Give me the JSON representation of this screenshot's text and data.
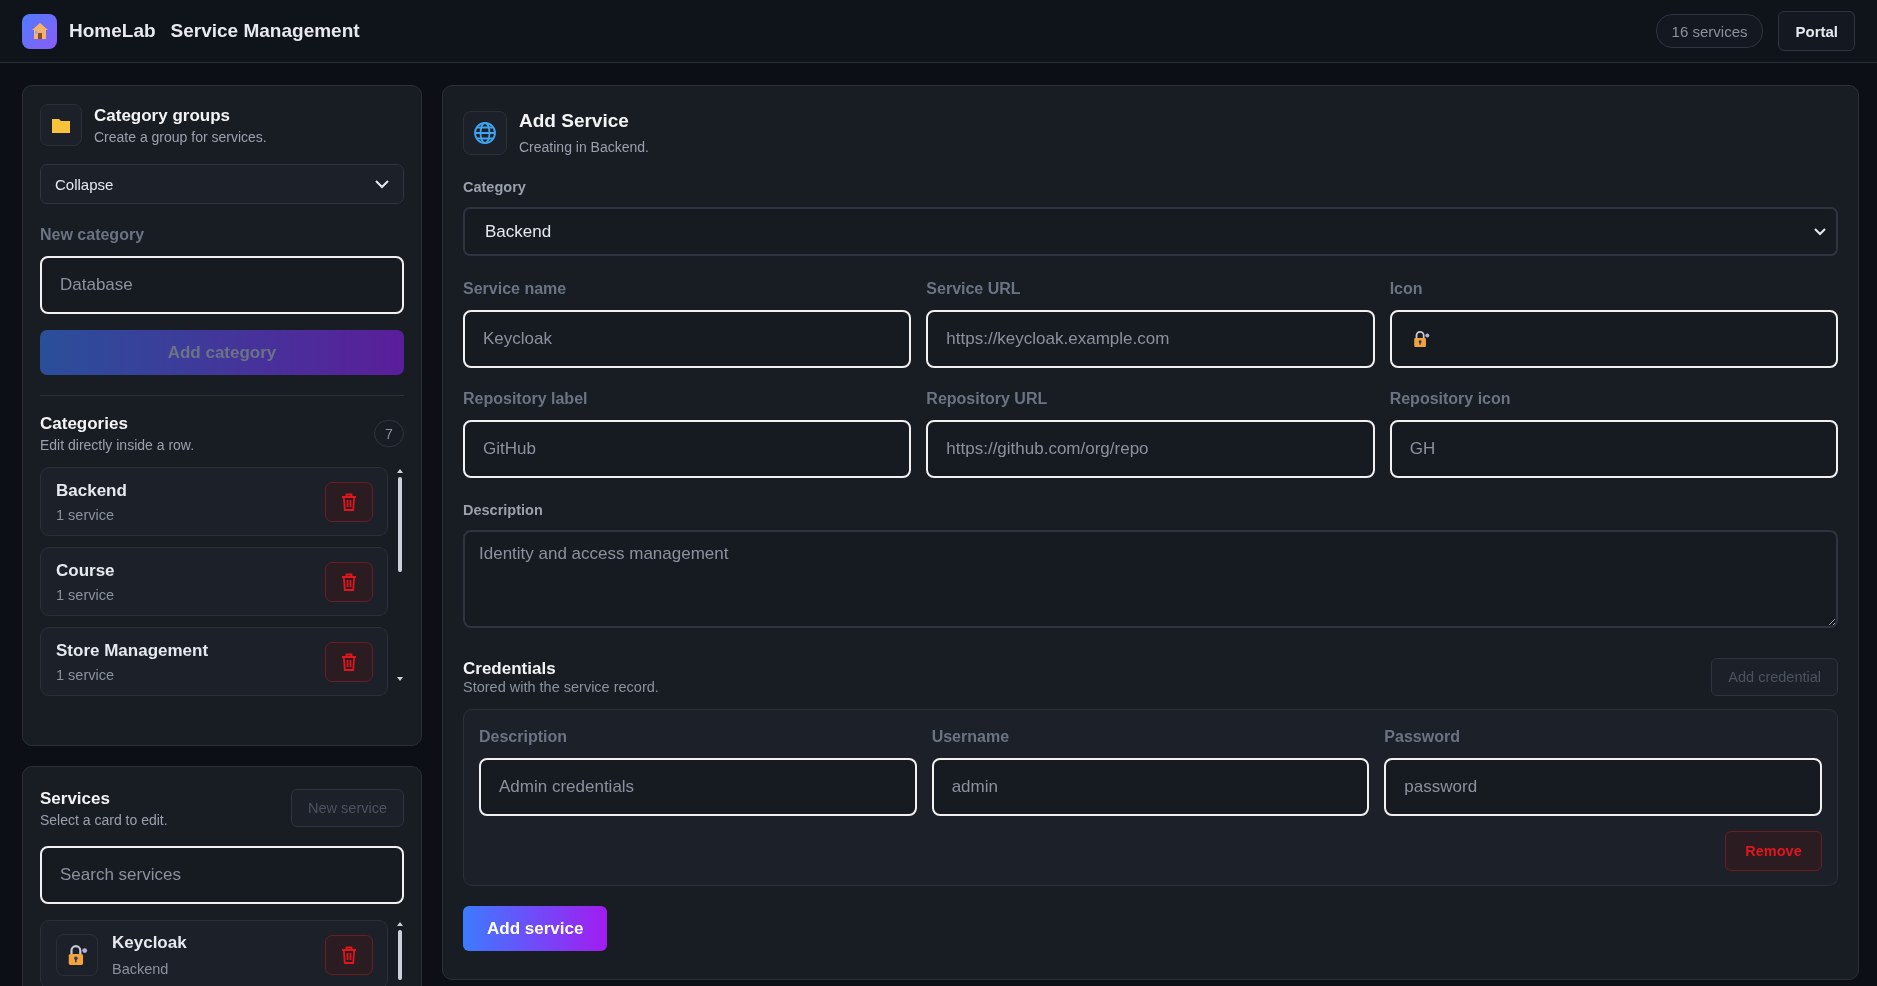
{
  "header": {
    "brand": "HomeLab",
    "title": "Service Management",
    "count_badge": "16 services",
    "portal_button": "Portal"
  },
  "category_groups": {
    "title": "Category groups",
    "subtitle": "Create a group for services.",
    "mode_select": {
      "value": "Collapse"
    },
    "new_category": {
      "label": "New category",
      "placeholder": "Database"
    },
    "add_button": {
      "label": "Add category",
      "disabled": true
    },
    "categories_title": "Categories",
    "categories_subtitle": "Edit directly inside a row.",
    "count": "7",
    "items": [
      {
        "name": "Backend",
        "count": "1 service"
      },
      {
        "name": "Course",
        "count": "1 service"
      },
      {
        "name": "Store Management",
        "count": "1 service"
      }
    ]
  },
  "services": {
    "title": "Services",
    "subtitle": "Select a card to edit.",
    "new_button": {
      "label": "New service",
      "disabled": true
    },
    "search": {
      "placeholder": "Search services"
    },
    "items": [
      {
        "name": "Keycloak",
        "category": "Backend"
      }
    ]
  },
  "form": {
    "title": "Add Service",
    "subtitle": "Creating in Backend.",
    "category": {
      "label": "Category",
      "value": "Backend"
    },
    "fields": [
      {
        "kind": "text",
        "label": "Service name",
        "placeholder": "Keycloak"
      },
      {
        "kind": "text",
        "label": "Service URL",
        "placeholder": "https://keycloak.example.com"
      },
      {
        "kind": "icon",
        "label": "Icon"
      },
      {
        "kind": "text",
        "label": "Repository label",
        "placeholder": "GitHub"
      },
      {
        "kind": "text",
        "label": "Repository URL",
        "placeholder": "https://github.com/org/repo"
      },
      {
        "kind": "text",
        "label": "Repository icon",
        "placeholder": "GH"
      }
    ],
    "description": {
      "label": "Description",
      "placeholder": "Identity and access management"
    },
    "credentials": {
      "title": "Credentials",
      "subtitle": "Stored with the service record.",
      "add_button": {
        "label": "Add credential",
        "disabled": true
      },
      "items": [
        {
          "fields": [
            {
              "label": "Description",
              "placeholder": "Admin credentials"
            },
            {
              "label": "Username",
              "placeholder": "admin"
            },
            {
              "label": "Password",
              "placeholder": "password"
            }
          ],
          "remove_button": "Remove"
        }
      ]
    },
    "submit_button": {
      "label": "Add service",
      "disabled": false
    }
  }
}
